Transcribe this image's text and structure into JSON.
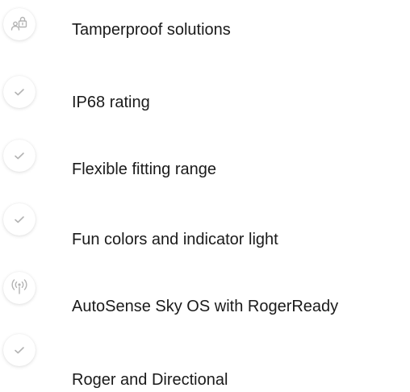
{
  "features": {
    "items": [
      {
        "label": "Tamperproof solutions",
        "icon": "child-lock-icon"
      },
      {
        "label": "IP68 rating",
        "icon": "checkmark-icon"
      },
      {
        "label": "Flexible fitting range",
        "icon": "checkmark-icon"
      },
      {
        "label": "Fun colors and indicator light",
        "icon": "checkmark-icon"
      },
      {
        "label": "AutoSense Sky OS with RogerReady",
        "icon": "wireless-broadcast-icon"
      },
      {
        "label": "Roger and Directional",
        "icon": "checkmark-icon"
      }
    ]
  },
  "colors": {
    "icon_stroke": "#b3b3b3",
    "text": "#1a1a1a",
    "background": "#ffffff"
  }
}
